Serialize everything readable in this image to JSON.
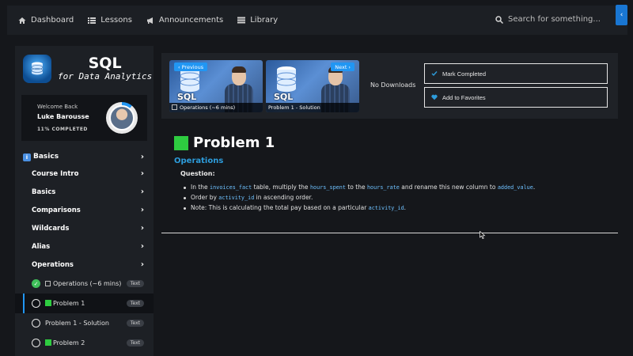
{
  "nav": {
    "items": [
      {
        "label": "Dashboard",
        "icon": "home-icon"
      },
      {
        "label": "Lessons",
        "icon": "list-icon"
      },
      {
        "label": "Announcements",
        "icon": "megaphone-icon"
      },
      {
        "label": "Library",
        "icon": "library-icon"
      }
    ],
    "search_placeholder": "Search for something..."
  },
  "sidebar": {
    "logo_title": "SQL",
    "logo_subtitle": "for Data Analytics",
    "welcome": "Welcome Back",
    "user_name": "Luke Barousse",
    "progress_text": "11% COMPLETED",
    "progress_fraction": 0.11,
    "section": "Basics",
    "modules": [
      "Course Intro",
      "Basics",
      "Comparisons",
      "Wildcards",
      "Alias",
      "Operations"
    ],
    "lessons": [
      {
        "label": "Operations (~6 mins)",
        "tag": "Text",
        "status": "done",
        "prefix": "calendar"
      },
      {
        "label": "Problem 1",
        "tag": "Text",
        "status": "active",
        "prefix": "green-square"
      },
      {
        "label": "Problem 1 - Solution",
        "tag": "Text",
        "status": "open",
        "prefix": ""
      },
      {
        "label": "Problem 2",
        "tag": "Text",
        "status": "open",
        "prefix": "green-square"
      }
    ]
  },
  "media": {
    "prev_label": "Previous",
    "next_label": "Next",
    "prev_caption": "Operations (~6 mins)",
    "next_caption": "Problem 1 - Solution",
    "thumb_text": "SQL",
    "no_downloads": "No Downloads",
    "mark_completed": "Mark Completed",
    "add_favorites": "Add to Favorites"
  },
  "content": {
    "title": "Problem 1",
    "subtitle": "Operations",
    "question_label": "Question:",
    "b1": {
      "t1": "In the ",
      "c1": "invoices_fact",
      "t2": " table, multiply the ",
      "c2": "hours_spent",
      "t3": " to the ",
      "c3": "hours_rate",
      "t4": " and rename this new column to ",
      "c4": "added_value",
      "t5": "."
    },
    "b2": {
      "t1": "Order by ",
      "c1": "activity_id",
      "t2": " in ascending order."
    },
    "b3": {
      "t1": "Note: This is calculating the total pay based on a particular ",
      "c1": "activity_id",
      "t2": "."
    }
  },
  "colors": {
    "accent": "#2196f3",
    "success": "#2ecc40",
    "link": "#2d9cdb",
    "code": "#6ec1ff"
  }
}
